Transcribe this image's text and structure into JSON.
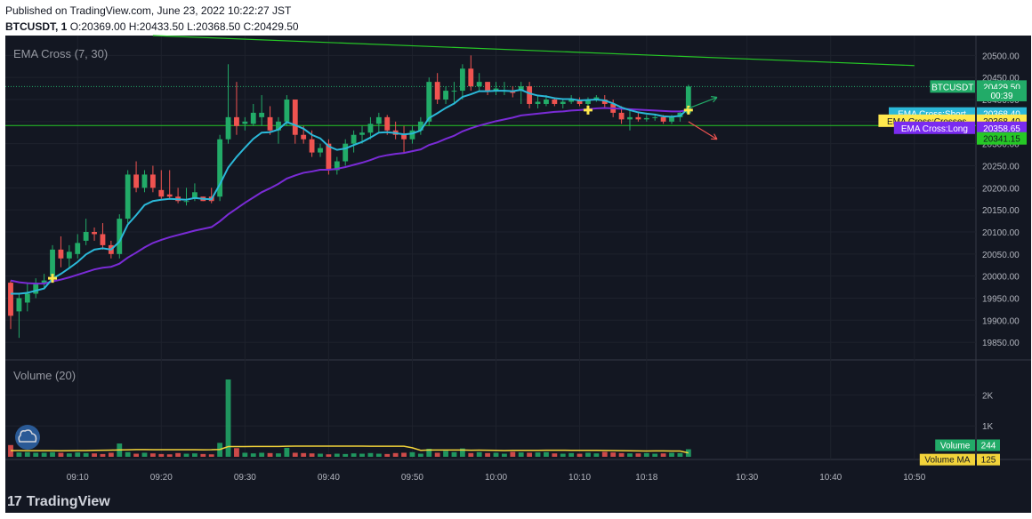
{
  "header": {
    "published": "Published on TradingView.com, June 23, 2022 10:22:27 JST",
    "symbol": "BTCUSDT, 1",
    "ohlc": "O:20369.00 H:20433.50 L:20368.50 C:20429.50"
  },
  "branding": {
    "name": "TradingView",
    "logo_icon": "tradingview-logo-icon"
  },
  "colors": {
    "background": "#131722",
    "up": "#26a69a",
    "up_bar": "#22ab68",
    "down": "#ef5350",
    "ema_short": "#2bb8d8",
    "ema_long": "#7a2bd6",
    "trend_line": "#26c826",
    "volume_ma": "#f2d33a",
    "cross_marker": "#ffe94d"
  },
  "chart_data": [
    {
      "type": "candlestick",
      "pane": "price",
      "indicator_title": "EMA Cross (7, 30)",
      "ylim": [
        19810,
        20545
      ],
      "y_ticks": [
        19850,
        19900,
        19950,
        20000,
        20050,
        20100,
        20150,
        20200,
        20250,
        20300,
        20350,
        20400,
        20450,
        20500
      ],
      "x_tick_labels": [
        {
          "i": 8,
          "label": "09:10"
        },
        {
          "i": 18,
          "label": "09:20"
        },
        {
          "i": 28,
          "label": "09:30"
        },
        {
          "i": 38,
          "label": "09:40"
        },
        {
          "i": 48,
          "label": "09:50"
        },
        {
          "i": 58,
          "label": "10:00"
        },
        {
          "i": 68,
          "label": "10:10"
        },
        {
          "i": 76,
          "label": "10:18"
        },
        {
          "i": 88,
          "label": "10:30"
        },
        {
          "i": 98,
          "label": "10:40"
        },
        {
          "i": 108,
          "label": "10:50"
        }
      ],
      "x_count": 116,
      "ohlc": [
        [
          19985,
          19990,
          19880,
          19910
        ],
        [
          19920,
          19960,
          19860,
          19950
        ],
        [
          19940,
          19985,
          19920,
          19960
        ],
        [
          19960,
          19995,
          19950,
          19985
        ],
        [
          19985,
          20005,
          19970,
          19990
        ],
        [
          20000,
          20070,
          19990,
          20060
        ],
        [
          20060,
          20090,
          20020,
          20040
        ],
        [
          20040,
          20070,
          20020,
          20055
        ],
        [
          20050,
          20095,
          20040,
          20075
        ],
        [
          20080,
          20130,
          20070,
          20100
        ],
        [
          20100,
          20110,
          20080,
          20095
        ],
        [
          20095,
          20120,
          20060,
          20070
        ],
        [
          20070,
          20080,
          20040,
          20050
        ],
        [
          20050,
          20140,
          20040,
          20130
        ],
        [
          20130,
          20240,
          20120,
          20230
        ],
        [
          20230,
          20260,
          20190,
          20200
        ],
        [
          20200,
          20240,
          20190,
          20230
        ],
        [
          20230,
          20250,
          20190,
          20200
        ],
        [
          20195,
          20240,
          20175,
          20180
        ],
        [
          20185,
          20240,
          20175,
          20180
        ],
        [
          20180,
          20200,
          20165,
          20170
        ],
        [
          20170,
          20200,
          20160,
          20170
        ],
        [
          20175,
          20210,
          20170,
          20190
        ],
        [
          20180,
          20180,
          20170,
          20170
        ],
        [
          20180,
          20200,
          20165,
          20170
        ],
        [
          20180,
          20320,
          20170,
          20310
        ],
        [
          20310,
          20480,
          20300,
          20360
        ],
        [
          20360,
          20440,
          20320,
          20340
        ],
        [
          20345,
          20360,
          20330,
          20350
        ],
        [
          20345,
          20390,
          20340,
          20370
        ],
        [
          20360,
          20410,
          20340,
          20370
        ],
        [
          20360,
          20385,
          20320,
          20330
        ],
        [
          20330,
          20360,
          20300,
          20350
        ],
        [
          20350,
          20410,
          20340,
          20400
        ],
        [
          20400,
          20400,
          20300,
          20320
        ],
        [
          20320,
          20340,
          20300,
          20310
        ],
        [
          20310,
          20330,
          20270,
          20280
        ],
        [
          20280,
          20300,
          20270,
          20290
        ],
        [
          20300,
          20310,
          20230,
          20240
        ],
        [
          20240,
          20270,
          20230,
          20260
        ],
        [
          20260,
          20310,
          20250,
          20300
        ],
        [
          20300,
          20330,
          20280,
          20320
        ],
        [
          20320,
          20340,
          20300,
          20325
        ],
        [
          20325,
          20360,
          20310,
          20345
        ],
        [
          20345,
          20370,
          20325,
          20360
        ],
        [
          20360,
          20365,
          20320,
          20330
        ],
        [
          20330,
          20350,
          20310,
          20320
        ],
        [
          20320,
          20340,
          20280,
          20310
        ],
        [
          20310,
          20340,
          20300,
          20330
        ],
        [
          20330,
          20360,
          20320,
          20350
        ],
        [
          20350,
          20450,
          20340,
          20440
        ],
        [
          20440,
          20460,
          20390,
          20400
        ],
        [
          20400,
          20430,
          20390,
          20420
        ],
        [
          20420,
          20440,
          20390,
          20420
        ],
        [
          20420,
          20480,
          20400,
          20470
        ],
        [
          20470,
          20500,
          20420,
          20430
        ],
        [
          20430,
          20460,
          20420,
          20440
        ],
        [
          20440,
          20440,
          20410,
          20420
        ],
        [
          20420,
          20440,
          20410,
          20425
        ],
        [
          20420,
          20440,
          20410,
          20420
        ],
        [
          20420,
          20430,
          20405,
          20415
        ],
        [
          20420,
          20440,
          20390,
          20430
        ],
        [
          20430,
          20440,
          20380,
          20390
        ],
        [
          20390,
          20410,
          20380,
          20395
        ],
        [
          20390,
          20410,
          20385,
          20400
        ],
        [
          20400,
          20405,
          20385,
          20390
        ],
        [
          20390,
          20400,
          20380,
          20395
        ],
        [
          20395,
          20410,
          20390,
          20400
        ],
        [
          20400,
          20405,
          20385,
          20390
        ],
        [
          20390,
          20405,
          20385,
          20400
        ],
        [
          20400,
          20410,
          20395,
          20405
        ],
        [
          20400,
          20410,
          20380,
          20390
        ],
        [
          20390,
          20400,
          20360,
          20370
        ],
        [
          20370,
          20385,
          20345,
          20355
        ],
        [
          20355,
          20375,
          20330,
          20360
        ],
        [
          20360,
          20370,
          20350,
          20355
        ],
        [
          20355,
          20365,
          20350,
          20358
        ],
        [
          20358,
          20365,
          20352,
          20360
        ],
        [
          20360,
          20365,
          20345,
          20350
        ],
        [
          20350,
          20365,
          20345,
          20360
        ],
        [
          20360,
          20375,
          20350,
          20370
        ],
        [
          20369,
          20433.5,
          20368.5,
          20429.5
        ]
      ],
      "ema_short": [
        19960,
        19960,
        19962,
        19967,
        19972,
        19994,
        20005,
        20018,
        20032,
        20049,
        20060,
        20063,
        20060,
        20078,
        20117,
        20138,
        20161,
        20170,
        20173,
        20175,
        20174,
        20173,
        20177,
        20175,
        20174,
        20208,
        20246,
        20270,
        20291,
        20311,
        20325,
        20326,
        20332,
        20349,
        20342,
        20334,
        20320,
        20312,
        20294,
        20286,
        20289,
        20297,
        20304,
        20314,
        20325,
        20326,
        20324,
        20321,
        20323,
        20330,
        20358,
        20369,
        20381,
        20391,
        20406,
        20412,
        20419,
        20419,
        20420,
        20420,
        20419,
        20422,
        20414,
        20409,
        20407,
        20403,
        20401,
        20401,
        20398,
        20399,
        20400,
        20398,
        20391,
        20382,
        20376,
        20371,
        20368,
        20366,
        20362,
        20361,
        20363,
        20380
      ],
      "ema_long": [
        19990,
        19986,
        19984,
        19983,
        19983,
        19988,
        19992,
        19997,
        20003,
        20009,
        20015,
        20019,
        20021,
        20028,
        20042,
        20053,
        20065,
        20075,
        20082,
        20088,
        20093,
        20098,
        20103,
        20107,
        20111,
        20124,
        20140,
        20153,
        20166,
        20178,
        20190,
        20199,
        20209,
        20221,
        20228,
        20234,
        20237,
        20241,
        20241,
        20243,
        20247,
        20252,
        20257,
        20263,
        20270,
        20274,
        20277,
        20279,
        20283,
        20287,
        20297,
        20303,
        20311,
        20318,
        20328,
        20335,
        20341,
        20346,
        20351,
        20355,
        20359,
        20364,
        20366,
        20368,
        20370,
        20372,
        20373,
        20375,
        20376,
        20378,
        20380,
        20381,
        20380,
        20379,
        20378,
        20377,
        20376,
        20375,
        20374,
        20373,
        20373,
        20376
      ],
      "trend_line": [
        {
          "i": 17,
          "v": 20545
        },
        {
          "i": 108,
          "v": 20477
        }
      ],
      "horizontal_level": 20341.15,
      "cross_markers": [
        {
          "i": 5,
          "v": 19995
        },
        {
          "i": 69,
          "v": 20376
        },
        {
          "i": 81,
          "v": 20376
        }
      ],
      "arrows": [
        {
          "from_i": 81,
          "from_v": 20380,
          "to_i": 84,
          "to_v": 20405,
          "dir": "up"
        },
        {
          "from_i": 81,
          "from_v": 20350,
          "to_i": 84,
          "to_v": 20310,
          "dir": "down"
        }
      ],
      "price_labels": [
        {
          "text": "20429.50",
          "title": "BTCUSDT",
          "v": 20429.5,
          "role": "last"
        },
        {
          "text": "00:39",
          "title": "",
          "v": 20410,
          "role": "countdown"
        },
        {
          "text": "20368.40",
          "title": "EMA Cross:Short",
          "v": 20368.4,
          "role": "ema_short"
        },
        {
          "text": "20368.40",
          "title": "EMA Cross:Crosses",
          "v": 20352,
          "role": "crosses"
        },
        {
          "text": "20358.65",
          "title": "EMA Cross:Long",
          "v": 20336,
          "role": "ema_long"
        },
        {
          "text": "20341.15",
          "title": "",
          "v": 20312,
          "role": "level"
        }
      ]
    },
    {
      "type": "bar",
      "pane": "volume",
      "indicator_title": "Volume (20)",
      "ylim": [
        0,
        2500
      ],
      "y_ticks": [
        {
          "v": 1000,
          "label": "1K"
        },
        {
          "v": 2000,
          "label": "2K"
        }
      ],
      "values": [
        380,
        140,
        150,
        130,
        130,
        150,
        130,
        110,
        140,
        120,
        110,
        90,
        130,
        430,
        150,
        100,
        130,
        110,
        90,
        80,
        120,
        100,
        110,
        90,
        80,
        450,
        2500,
        280,
        130,
        110,
        130,
        120,
        110,
        290,
        130,
        120,
        110,
        100,
        80,
        100,
        90,
        110,
        100,
        120,
        100,
        90,
        120,
        130,
        150,
        100,
        260,
        130,
        190,
        150,
        270,
        120,
        150,
        120,
        130,
        100,
        160,
        140,
        130,
        140,
        150,
        110,
        100,
        120,
        100,
        130,
        110,
        160,
        140,
        120,
        110,
        110,
        120,
        100,
        110,
        130,
        120,
        244
      ],
      "volume_ma": [
        200,
        200,
        198,
        196,
        196,
        196,
        195,
        196,
        200,
        202,
        208,
        211,
        215,
        222,
        228,
        232,
        232,
        231,
        231,
        230,
        230,
        229,
        229,
        228,
        229,
        238,
        330,
        330,
        332,
        333,
        333,
        333,
        335,
        343,
        345,
        346,
        346,
        346,
        345,
        345,
        345,
        345,
        345,
        343,
        342,
        341,
        342,
        342,
        290,
        210,
        220,
        220,
        220,
        220,
        218,
        212,
        214,
        212,
        210,
        200,
        208,
        210,
        210,
        210,
        211,
        212,
        211,
        210,
        210,
        210,
        208,
        205,
        200,
        198,
        193,
        190,
        188,
        190,
        190,
        188,
        186,
        125
      ],
      "value_labels": [
        {
          "title": "Volume",
          "text": "244",
          "role": "volume"
        },
        {
          "title": "Volume MA",
          "text": "125",
          "role": "volume_ma"
        }
      ]
    }
  ]
}
